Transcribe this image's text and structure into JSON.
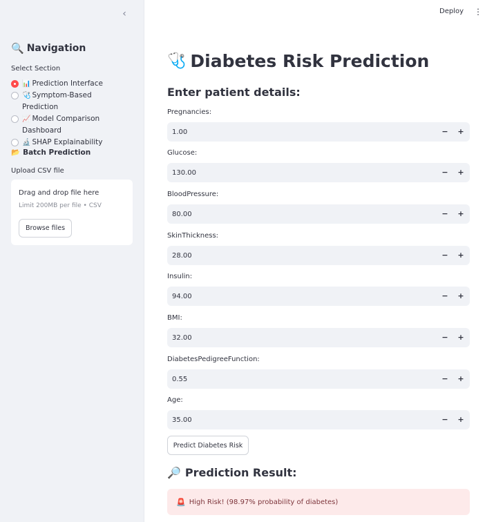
{
  "header": {
    "deploy_label": "Deploy",
    "menu_icon": "⋮"
  },
  "sidebar": {
    "collapse_icon": "‹",
    "nav_icon": "🔍",
    "nav_title": "Navigation",
    "select_label": "Select Section",
    "sections": [
      {
        "icon": "📊",
        "label": "Prediction Interface",
        "selected": true
      },
      {
        "icon": "🩺",
        "label": "Symptom-Based Prediction",
        "selected": false
      },
      {
        "icon": "📈",
        "label": "Model Comparison Dashboard",
        "selected": false
      },
      {
        "icon": "🔬",
        "label": "SHAP Explainability",
        "selected": false
      }
    ],
    "batch_icon": "📂",
    "batch_title": "Batch Prediction",
    "upload_label": "Upload CSV file",
    "dropzone": {
      "title": "Drag and drop file here",
      "limit": "Limit 200MB per file • CSV",
      "browse_label": "Browse files"
    }
  },
  "main": {
    "title_icon": "🩺",
    "title": "Diabetes Risk Prediction",
    "subheader": "Enter patient details:",
    "fields": [
      {
        "label": "Pregnancies:",
        "value": "1.00"
      },
      {
        "label": "Glucose:",
        "value": "130.00"
      },
      {
        "label": "BloodPressure:",
        "value": "80.00"
      },
      {
        "label": "SkinThickness:",
        "value": "28.00"
      },
      {
        "label": "Insulin:",
        "value": "94.00"
      },
      {
        "label": "BMI:",
        "value": "32.00"
      },
      {
        "label": "DiabetesPedigreeFunction:",
        "value": "0.55"
      },
      {
        "label": "Age:",
        "value": "35.00"
      }
    ],
    "stepper_minus": "−",
    "stepper_plus": "+",
    "predict_label": "Predict Diabetes Risk",
    "result_icon": "🔎",
    "result_title": "Prediction Result:",
    "alert_icon": "🚨",
    "alert_text": "High Risk! (98.97% probability of diabetes)"
  },
  "colors": {
    "accent": "#ff4b4b",
    "sidebar_bg": "#f0f2f6",
    "input_bg": "#f0f2f6",
    "alert_bg": "#fdeaea",
    "alert_text": "#7d353b"
  }
}
